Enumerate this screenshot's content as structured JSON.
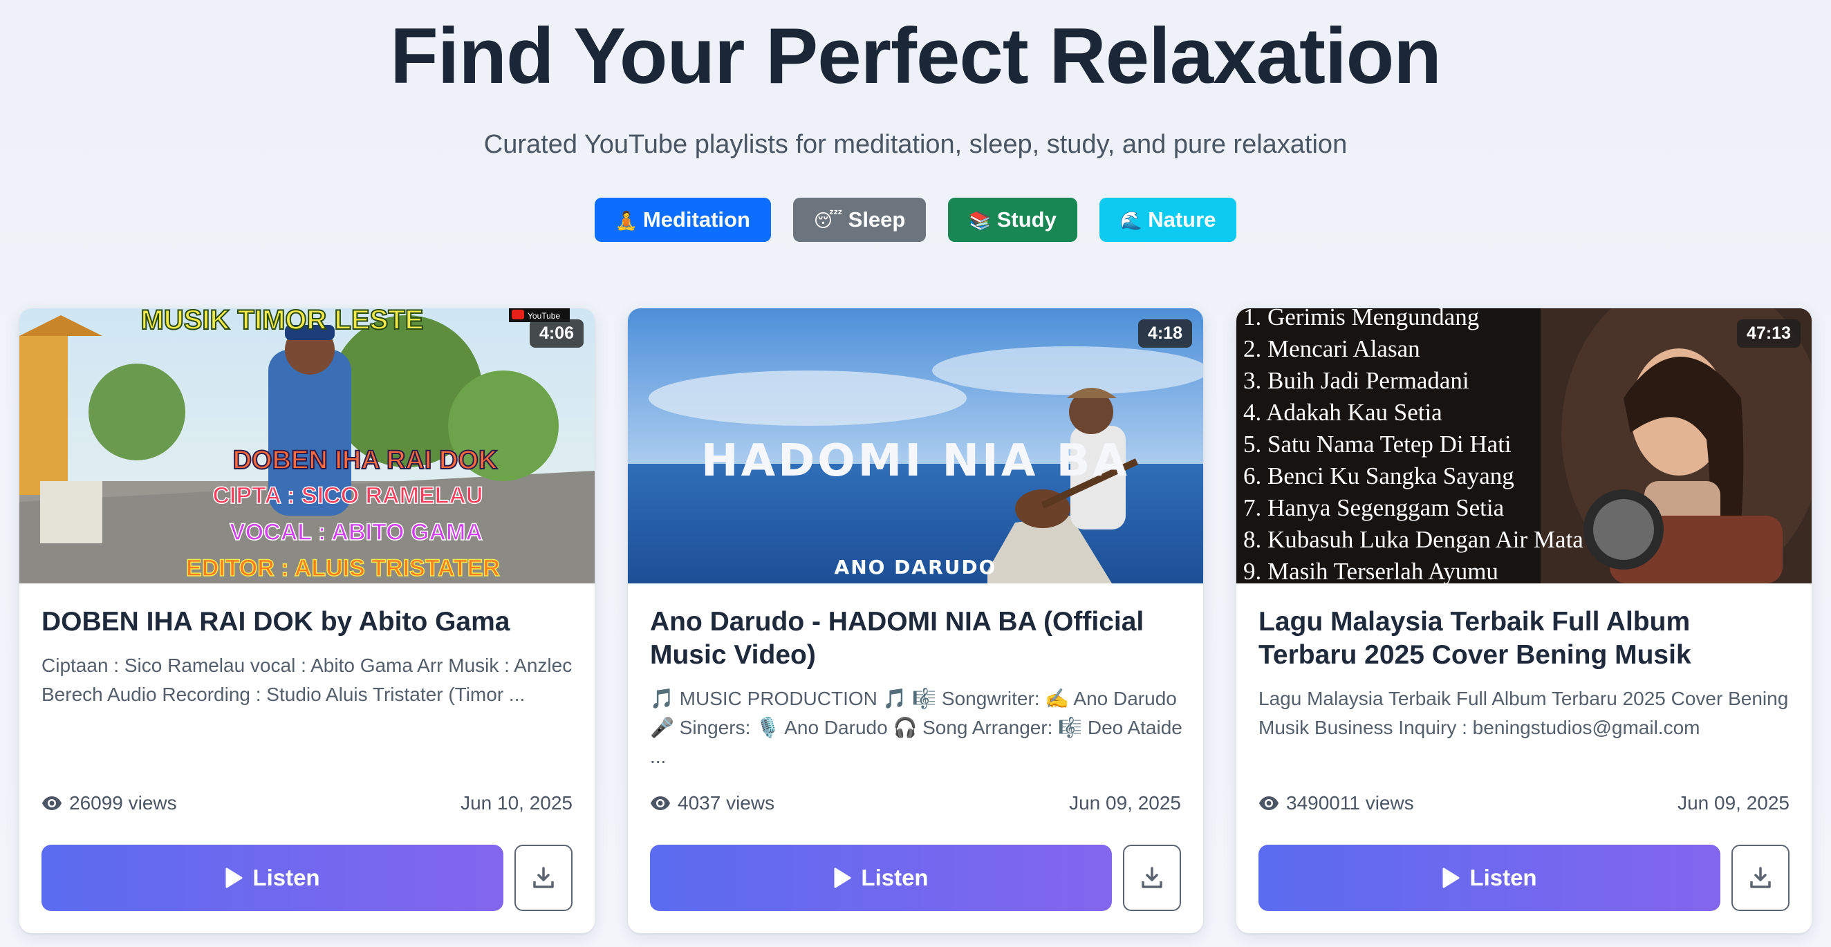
{
  "hero": {
    "title": "Find Your Perfect Relaxation",
    "subtitle": "Curated YouTube playlists for meditation, sleep, study, and pure relaxation"
  },
  "filters": [
    {
      "emoji": "🧘",
      "label": "Meditation",
      "color": "#0d6efd"
    },
    {
      "emoji": "😴",
      "label": "Sleep",
      "color": "#6c757d"
    },
    {
      "emoji": "📚",
      "label": "Study",
      "color": "#198754"
    },
    {
      "emoji": "🌊",
      "label": "Nature",
      "color": "#0dcaf0"
    }
  ],
  "videos": [
    {
      "duration": "4:06",
      "title": "DOBEN IHA RAI DOK by Abito Gama",
      "description": "Ciptaan : Sico Ramelau vocal : Abito Gama Arr Musik : Anzlec Berech Audio Recording : Studio Aluis Tristater (Timor ...",
      "views": "26099 views",
      "date": "Jun 10, 2025",
      "thumb_text": {
        "banner": "MUSIK TIMOR LESTE",
        "line1": "DOBEN IHA RAI DOK",
        "line2": "CIPTA : SICO RAMELAU",
        "line3": "VOCAL : ABITO GAMA",
        "line4": "EDITOR : ALUIS TRISTATER",
        "logo": "YouTube"
      }
    },
    {
      "duration": "4:18",
      "title": "Ano Darudo - HADOMI NIA BA (Official Music Video)",
      "description": "🎵 MUSIC PRODUCTION 🎵 🎼 Songwriter: ✍️ Ano Darudo 🎤 Singers: 🎙️ Ano Darudo 🎧 Song Arranger: 🎼 Deo Ataide ...",
      "views": "4037 views",
      "date": "Jun 09, 2025",
      "thumb_text": {
        "main": "HADOMI NIA BA",
        "artist": "ANO DARUDO"
      }
    },
    {
      "duration": "47:13",
      "title": "Lagu Malaysia Terbaik Full Album Terbaru 2025 Cover Bening Musik",
      "description": "Lagu Malaysia Terbaik Full Album Terbaru 2025 Cover Bening Musik Business Inquiry : beningstudios@gmail.com",
      "views": "3490011 views",
      "date": "Jun 09, 2025",
      "thumb_tracks": [
        "1. Gerimis Mengundang",
        "2. Mencari Alasan",
        "3. Buih Jadi Permadani",
        "4. Adakah Kau Setia",
        "5. Satu Nama Tetep Di Hati",
        "6. Benci Ku Sangka Sayang",
        "7. Hanya Segenggam Setia",
        "8. Kubasuh Luka Dengan Air Mata",
        "9. Masih Terserlah Ayumu"
      ]
    }
  ],
  "actions": {
    "listen_label": "Listen"
  }
}
